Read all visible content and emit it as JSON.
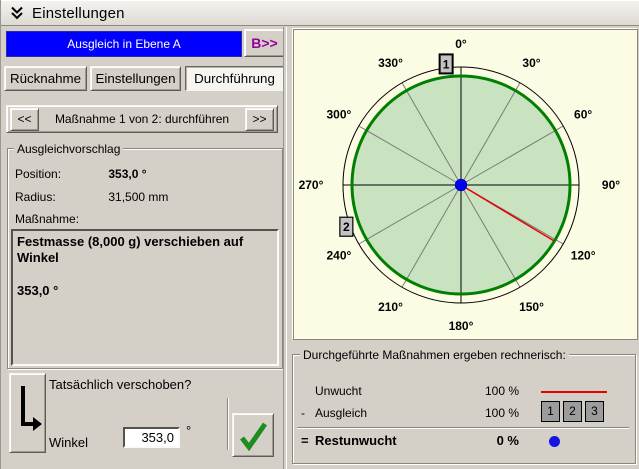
{
  "window": {
    "title": "Einstellungen"
  },
  "header": {
    "plane_banner": "Ausgleich in Ebene A",
    "plane_switch_label": "B>>"
  },
  "tabs": [
    {
      "label": "Rücknahme",
      "active": false
    },
    {
      "label": "Einstellungen",
      "active": false
    },
    {
      "label": "Durchführung",
      "active": true
    }
  ],
  "stepper": {
    "prev_label": "<<",
    "label": "Maßnahme 1 von 2: durchführen",
    "next_label": ">>"
  },
  "proposal": {
    "title": "Ausgleichvorschlag",
    "position_label": "Position:",
    "position_value": "353,0 °",
    "radius_label": "Radius:",
    "radius_value": "31,500 mm",
    "measure_label": "Maßnahme:",
    "measure_text": "Festmasse (8,000 g) verschieben auf Winkel",
    "measure_angle": "353,0 °"
  },
  "confirm": {
    "question": "Tatsächlich verschoben?",
    "angle_label": "Winkel",
    "angle_value": "353,0",
    "unit": "°",
    "arrow_icon": "down-right-arrow",
    "ok_icon": "green-checkmark"
  },
  "chart_data": {
    "type": "polar",
    "angles_deg": [
      0,
      30,
      60,
      90,
      120,
      150,
      180,
      210,
      240,
      270,
      300,
      330
    ],
    "angle_labels": [
      "0°",
      "30°",
      "60°",
      "90°",
      "120°",
      "150°",
      "180°",
      "210°",
      "240°",
      "270°",
      "300°",
      "330°"
    ],
    "axis_angles_deg": [
      0,
      90,
      180,
      270
    ],
    "markers": [
      {
        "label": "1",
        "angle_deg": 353
      },
      {
        "label": "2",
        "angle_deg": 250
      }
    ],
    "unbalance_line": {
      "angle_deg": 121,
      "color": "#e80000"
    },
    "rest_unbalance_dot": {
      "radius_pct": 0,
      "color": "#0000ee"
    },
    "circle_fill": "#c9e3c0",
    "circle_stroke": "#008000",
    "spoke_color": "#7a7a7a",
    "background": "#fcfbe3"
  },
  "results": {
    "title": "Durchgeführte Maßnahmen ergeben rechnerisch:",
    "rows": [
      {
        "prefix": "",
        "label": "Unwucht",
        "value": "100 %",
        "symbol": "red-line"
      },
      {
        "prefix": "-",
        "label": "Ausgleich",
        "value": "100 %",
        "symbol": "measure-squares",
        "squares": [
          "1",
          "2",
          "3"
        ]
      },
      {
        "prefix": "=",
        "label": "Restunwucht",
        "value": "0 %",
        "symbol": "blue-dot"
      }
    ],
    "red_line_color": "#e80000",
    "dot_color": "#1414e6"
  }
}
